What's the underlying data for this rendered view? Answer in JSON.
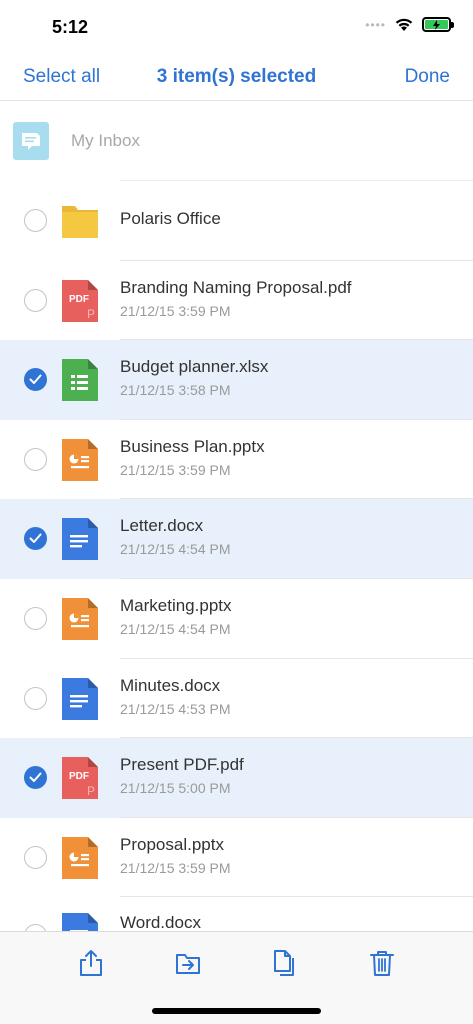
{
  "status_bar": {
    "time": "5:12",
    "signal": "••••",
    "wifi_icon": "wifi-icon",
    "battery_icon": "battery-charging-icon"
  },
  "nav": {
    "select_all": "Select all",
    "title": "3 item(s) selected",
    "done": "Done"
  },
  "inbox": {
    "label": "My Inbox",
    "icon": "inbox-icon"
  },
  "files": [
    {
      "name": "Polaris Office",
      "date": "",
      "type": "folder",
      "selected": false
    },
    {
      "name": "Branding Naming Proposal.pdf",
      "date": "21/12/15 3:59 PM",
      "type": "pdf",
      "selected": false
    },
    {
      "name": "Budget planner.xlsx",
      "date": "21/12/15 3:58 PM",
      "type": "xlsx",
      "selected": true
    },
    {
      "name": "Business Plan.pptx",
      "date": "21/12/15 3:59 PM",
      "type": "pptx",
      "selected": false
    },
    {
      "name": "Letter.docx",
      "date": "21/12/15 4:54 PM",
      "type": "docx",
      "selected": true
    },
    {
      "name": "Marketing.pptx",
      "date": "21/12/15 4:54 PM",
      "type": "pptx",
      "selected": false
    },
    {
      "name": "Minutes.docx",
      "date": "21/12/15 4:53 PM",
      "type": "docx",
      "selected": false
    },
    {
      "name": "Present PDF.pdf",
      "date": "21/12/15 5:00 PM",
      "type": "pdf",
      "selected": true
    },
    {
      "name": "Proposal.pptx",
      "date": "21/12/15 3:59 PM",
      "type": "pptx",
      "selected": false
    },
    {
      "name": "Word.docx",
      "date": "",
      "type": "docx",
      "selected": false
    }
  ],
  "pdf_badge": "PDF",
  "toolbar": {
    "share_icon": "share-icon",
    "move_icon": "move-to-folder-icon",
    "copy_icon": "copy-icon",
    "delete_icon": "trash-icon"
  },
  "colors": {
    "accent": "#2f74d4",
    "selected_bg": "#e8f0fb",
    "folder": "#f5c842",
    "pdf": "#e8605d",
    "xlsx": "#4caf50",
    "pptx": "#f0913a",
    "docx": "#3b7be0"
  }
}
